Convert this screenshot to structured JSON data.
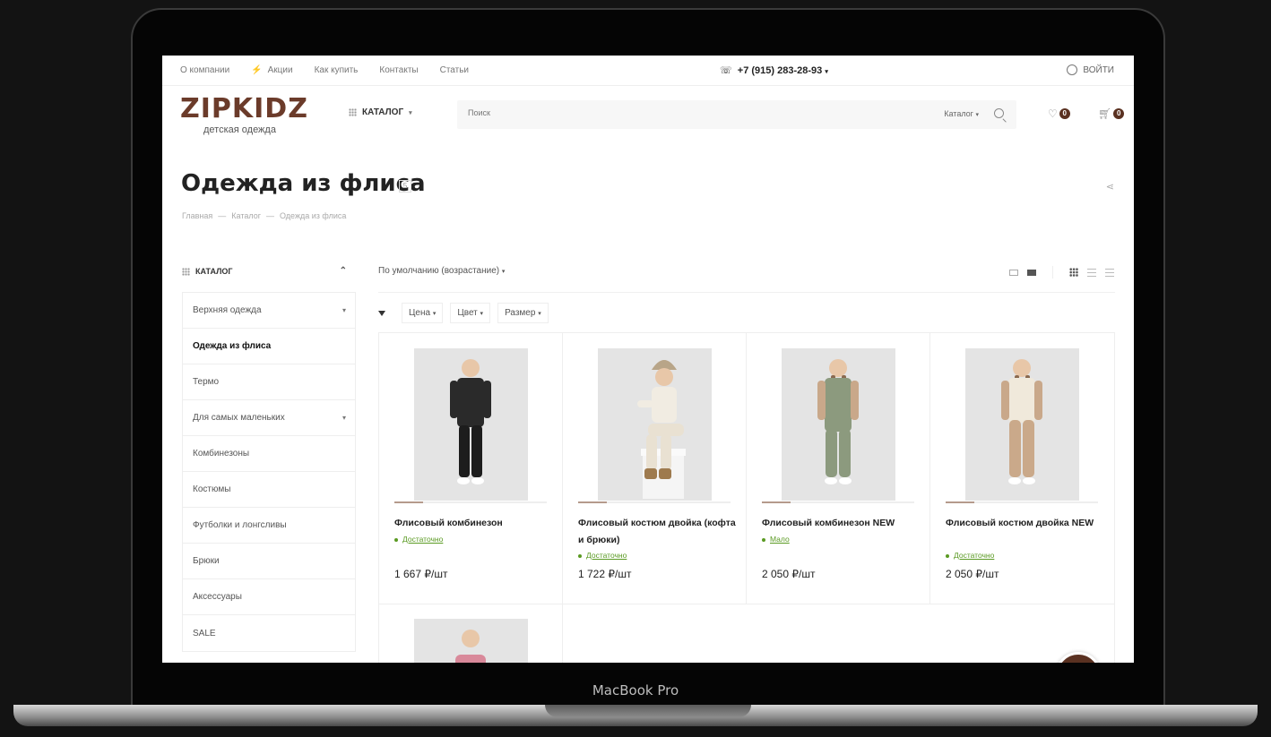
{
  "device_label": "MacBook Pro",
  "topbar": {
    "nav": [
      "О компании",
      "Акции",
      "Как купить",
      "Контакты",
      "Статьи"
    ],
    "phone": "+7 (915) 283-28-93",
    "login": "ВОЙТИ"
  },
  "header": {
    "logo": "ZIPKIDZ",
    "logo_sub": "детская одежда",
    "catalog_button": "КАТАЛОГ",
    "search_placeholder": "Поиск",
    "search_scope": "Каталог",
    "favorites_count": "0",
    "cart_count": "0",
    "brand_color": "#5a3121"
  },
  "page": {
    "title": "Одежда из флиса",
    "count": "5",
    "breadcrumbs": [
      "Главная",
      "—",
      "Каталог",
      "—",
      "Одежда из флиса"
    ]
  },
  "sidebar": {
    "heading": "КАТАЛОГ",
    "items": [
      {
        "label": "Верхняя одежда"
      },
      {
        "label": "Одежда из флиса"
      },
      {
        "label": "Термо"
      },
      {
        "label": "Для самых маленьких"
      },
      {
        "label": "Комбинезоны"
      },
      {
        "label": "Костюмы"
      },
      {
        "label": "Футболки и лонгсливы"
      },
      {
        "label": "Брюки"
      },
      {
        "label": "Аксессуары"
      },
      {
        "label": "SALE"
      }
    ]
  },
  "toolbar": {
    "sort": "По умолчанию (возрастание)",
    "filters": [
      "Цена",
      "Цвет",
      "Размер"
    ]
  },
  "products": [
    {
      "name": "Флисовый комбинезон",
      "stock": "Достаточно",
      "price": "1 667 ₽/шт",
      "colors": {
        "top": "#2a2a2a",
        "bottom": "#1d1d1d",
        "skin": "#e8c7a8"
      }
    },
    {
      "name": "Флисовый костюм двойка (кофта и брюки)",
      "stock": "Достаточно",
      "price": "1 722 ₽/шт",
      "colors": {
        "top": "#f1ece2",
        "bottom": "#e9e1d2",
        "skin": "#e8c7a8"
      }
    },
    {
      "name": "Флисовый комбинезон NEW",
      "stock": "Мало",
      "price": "2 050 ₽/шт",
      "colors": {
        "top": "#8c9a7e",
        "bottom": "#8c9a7e",
        "skin": "#e8c7a8"
      }
    },
    {
      "name": "Флисовый костюм двойка NEW",
      "stock": "Достаточно",
      "price": "2 050 ₽/шт",
      "colors": {
        "top": "#f0e9db",
        "bottom": "#caa98a",
        "skin": "#e8c7a8"
      }
    }
  ]
}
